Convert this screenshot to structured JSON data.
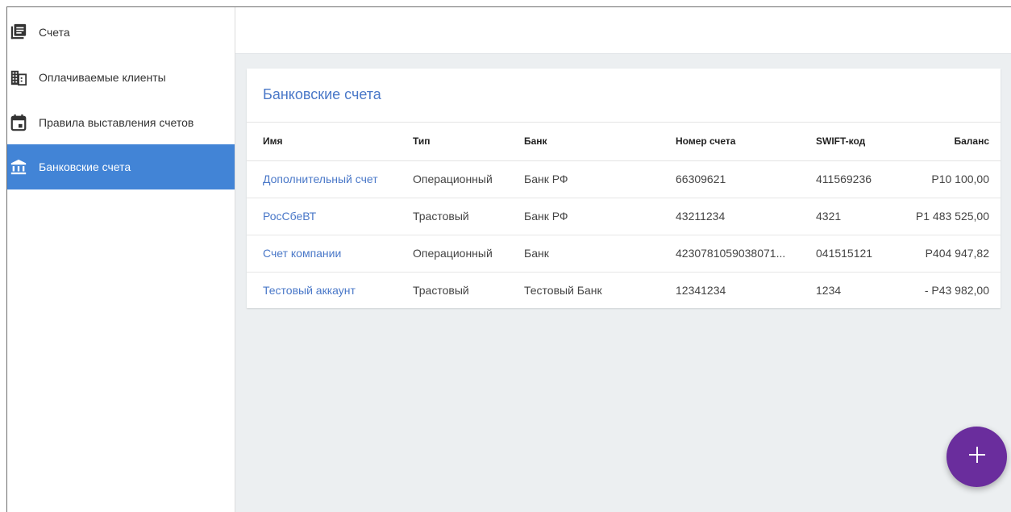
{
  "sidebar": {
    "items": [
      {
        "label": "Счета",
        "icon": "invoices-icon"
      },
      {
        "label": "Оплачиваемые клиенты",
        "icon": "building-icon"
      },
      {
        "label": "Правила выставления счетов",
        "icon": "calendar-icon"
      },
      {
        "label": "Банковские счета",
        "icon": "bank-icon",
        "active": true
      }
    ]
  },
  "main": {
    "card_title": "Банковские счета",
    "columns": [
      "Имя",
      "Тип",
      "Банк",
      "Номер счета",
      "SWIFT-код",
      "Баланс"
    ],
    "rows": [
      {
        "name": "Дополнительный счет",
        "type": "Операционный",
        "bank": "Банк РФ",
        "number": "66309621",
        "swift": "411569236",
        "balance": "Р10 100,00"
      },
      {
        "name": "РосСбеВТ",
        "type": "Трастовый",
        "bank": "Банк РФ",
        "number": "43211234",
        "swift": "4321",
        "balance": "Р1 483 525,00"
      },
      {
        "name": "Счет компании",
        "type": "Операционный",
        "bank": "Банк",
        "number": "4230781059038071...",
        "swift": "041515121",
        "balance": "Р404 947,82"
      },
      {
        "name": "Тестовый аккаунт",
        "type": "Трастовый",
        "bank": "Тестовый Банк",
        "number": "12341234",
        "swift": "1234",
        "balance": "- Р43 982,00"
      }
    ]
  },
  "fab": {
    "icon": "plus-icon",
    "label": "+"
  },
  "colors": {
    "accent": "#4284d6",
    "link": "#4a78c8",
    "fab": "#6a2d9d",
    "background": "#eceff1"
  }
}
